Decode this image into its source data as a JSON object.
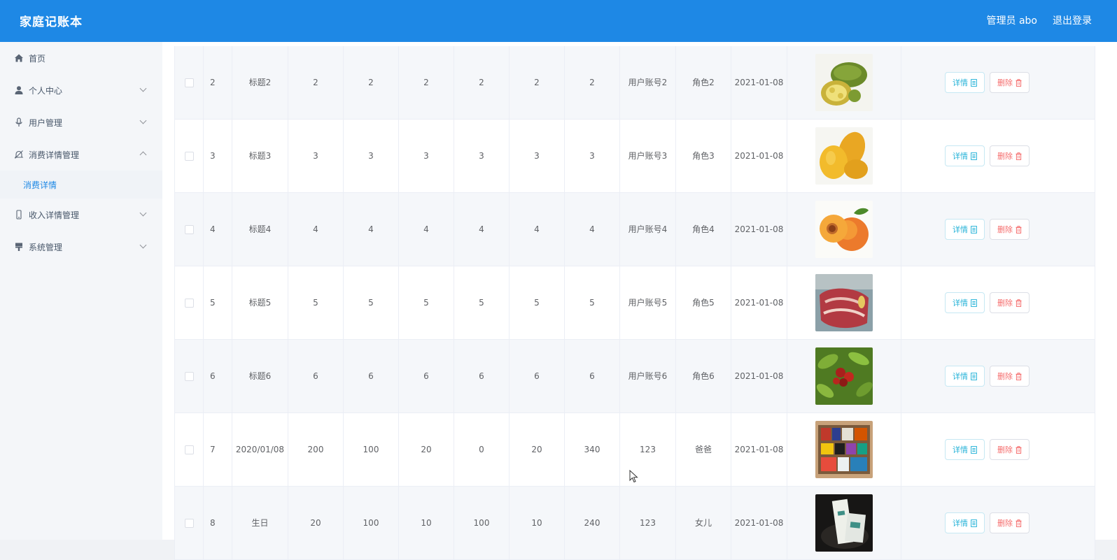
{
  "header": {
    "brand": "家庭记账本",
    "user": "管理员 abo",
    "logout": "退出登录"
  },
  "sidebar": {
    "items": [
      {
        "label": "首页",
        "icon": "home-icon",
        "expanded": null
      },
      {
        "label": "个人中心",
        "icon": "user-icon",
        "expanded": false
      },
      {
        "label": "用户管理",
        "icon": "microphone-icon",
        "expanded": false
      },
      {
        "label": "消费详情管理",
        "icon": "bell-off-icon",
        "expanded": true
      },
      {
        "label": "收入详情管理",
        "icon": "mobile-icon",
        "expanded": false
      },
      {
        "label": "系统管理",
        "icon": "brush-icon",
        "expanded": false
      }
    ],
    "active_sub": "消费详情"
  },
  "actions": {
    "detail": "详情",
    "delete": "删除"
  },
  "table": {
    "rows": [
      {
        "idx": "2",
        "title": "标题2",
        "v": [
          "2",
          "2",
          "2",
          "2",
          "2",
          "2"
        ],
        "account": "用户账号2",
        "role": "角色2",
        "date": "2021-01-08",
        "image": "jackfruit"
      },
      {
        "idx": "3",
        "title": "标题3",
        "v": [
          "3",
          "3",
          "3",
          "3",
          "3",
          "3"
        ],
        "account": "用户账号3",
        "role": "角色3",
        "date": "2021-01-08",
        "image": "mango"
      },
      {
        "idx": "4",
        "title": "标题4",
        "v": [
          "4",
          "4",
          "4",
          "4",
          "4",
          "4"
        ],
        "account": "用户账号4",
        "role": "角色4",
        "date": "2021-01-08",
        "image": "apricot"
      },
      {
        "idx": "5",
        "title": "标题5",
        "v": [
          "5",
          "5",
          "5",
          "5",
          "5",
          "5"
        ],
        "account": "用户账号5",
        "role": "角色5",
        "date": "2021-01-08",
        "image": "meat"
      },
      {
        "idx": "6",
        "title": "标题6",
        "v": [
          "6",
          "6",
          "6",
          "6",
          "6",
          "6"
        ],
        "account": "用户账号6",
        "role": "角色6",
        "date": "2021-01-08",
        "image": "dates-tree"
      },
      {
        "idx": "7",
        "title": "2020/01/08",
        "v": [
          "200",
          "100",
          "20",
          "0",
          "20",
          "340"
        ],
        "account": "123",
        "role": "爸爸",
        "date": "2021-01-08",
        "image": "groceries"
      },
      {
        "idx": "8",
        "title": "生日",
        "v": [
          "20",
          "100",
          "10",
          "100",
          "10",
          "240"
        ],
        "account": "123",
        "role": "女儿",
        "date": "2021-01-08",
        "image": "gift-box"
      }
    ]
  },
  "colors": {
    "topbar": "#1e88e5",
    "accent": "#1e88e5",
    "detail": "#26b3d8",
    "danger": "#f56c6c"
  }
}
